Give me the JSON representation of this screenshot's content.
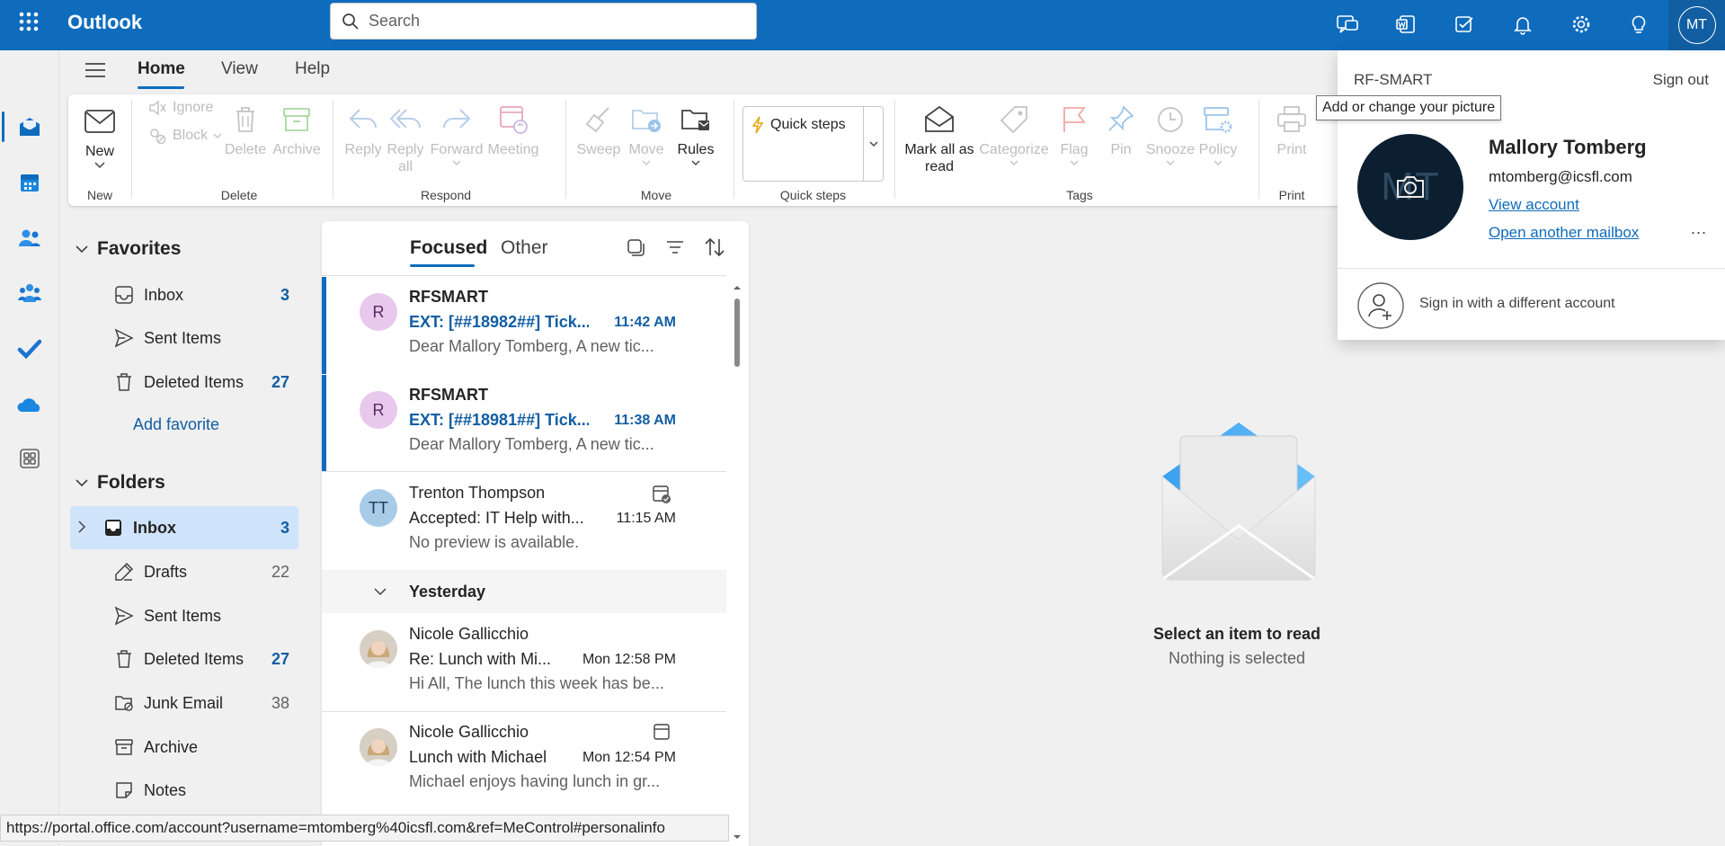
{
  "app": {
    "name": "Outlook"
  },
  "search": {
    "placeholder": "Search"
  },
  "me": {
    "initials": "MT"
  },
  "tabs": [
    {
      "label": "Home"
    },
    {
      "label": "View"
    },
    {
      "label": "Help"
    }
  ],
  "ribbon": {
    "new_label": "New",
    "ignore": "Ignore",
    "block": "Block",
    "delete": "Delete",
    "archive": "Archive",
    "reply": "Reply",
    "reply_all_1": "Reply",
    "reply_all_2": "all",
    "forward": "Forward",
    "meeting": "Meeting",
    "sweep": "Sweep",
    "move": "Move",
    "rules": "Rules",
    "quick_steps": "Quick steps",
    "mark_all_1": "Mark all as",
    "mark_all_2": "read",
    "categorize": "Categorize",
    "flag": "Flag",
    "pin": "Pin",
    "snooze": "Snooze",
    "policy": "Policy",
    "print": "Print",
    "groups": {
      "new": "New",
      "delete": "Delete",
      "respond": "Respond",
      "move": "Move",
      "quick": "Quick steps",
      "tags": "Tags",
      "print": "Print"
    }
  },
  "nav": {
    "favorites": "Favorites",
    "fav_items": [
      {
        "label": "Inbox",
        "count": "3"
      },
      {
        "label": "Sent Items",
        "count": ""
      },
      {
        "label": "Deleted Items",
        "count": "27"
      }
    ],
    "add_favorite": "Add favorite",
    "folders": "Folders",
    "folder_items": [
      {
        "label": "Inbox",
        "count": "3"
      },
      {
        "label": "Drafts",
        "count": "22"
      },
      {
        "label": "Sent Items",
        "count": ""
      },
      {
        "label": "Deleted Items",
        "count": "27"
      },
      {
        "label": "Junk Email",
        "count": "38"
      },
      {
        "label": "Archive",
        "count": ""
      },
      {
        "label": "Notes",
        "count": ""
      }
    ]
  },
  "list": {
    "tab_focused": "Focused",
    "tab_other": "Other",
    "day_yesterday": "Yesterday",
    "messages": [
      {
        "initials": "R",
        "sender": "RFSMART",
        "subject": "EXT: [##18982##] Tick...",
        "time": "11:42 AM",
        "preview": "Dear Mallory Tomberg, A new tic..."
      },
      {
        "initials": "R",
        "sender": "RFSMART",
        "subject": "EXT: [##18981##] Tick...",
        "time": "11:38 AM",
        "preview": "Dear Mallory Tomberg, A new tic..."
      },
      {
        "initials": "TT",
        "sender": "Trenton Thompson",
        "subject": "Accepted: IT Help with...",
        "time": "11:15 AM",
        "preview": "No preview is available."
      },
      {
        "initials": "",
        "sender": "Nicole Gallicchio",
        "subject": "Re: Lunch with Mi...",
        "time": "Mon 12:58 PM",
        "preview": "Hi All, The lunch this week has be..."
      },
      {
        "initials": "",
        "sender": "Nicole Gallicchio",
        "subject": "Lunch with Michael",
        "time": "Mon 12:54 PM",
        "preview": "Michael enjoys having lunch in gr..."
      }
    ]
  },
  "reading": {
    "title": "Select an item to read",
    "subtitle": "Nothing is selected"
  },
  "status": {
    "url": "https://portal.office.com/account?username=mtomberg%40icsfl.com&ref=MeControl#personalinfo"
  },
  "account": {
    "org": "RF-SMART",
    "sign_out": "Sign out",
    "tooltip": "Add or change your picture",
    "avatar_initials": "MT",
    "name": "Mallory Tomberg",
    "email": "mtomberg@icsfl.com",
    "view_account": "View account",
    "open_mailbox": "Open another mailbox",
    "more": "...",
    "sign_in_other": "Sign in with a different account"
  },
  "colors": {
    "brand": "#0f6cbd",
    "accent_dark": "#115ea3",
    "selected_bg": "#cfe4fa"
  }
}
